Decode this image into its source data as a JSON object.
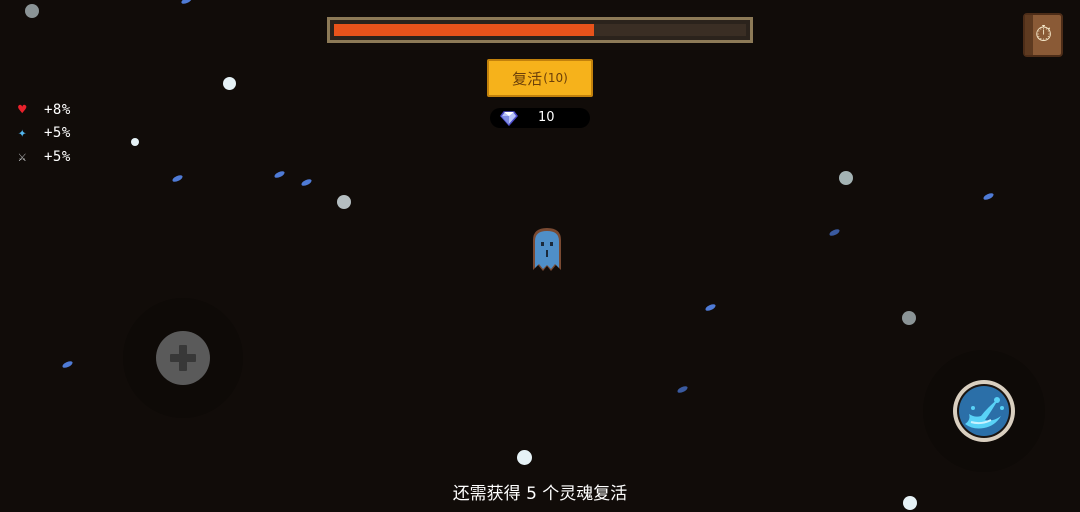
{
  "hud": {
    "progress": 0.63,
    "revive_button": {
      "label": "复活",
      "cost": "(10)"
    },
    "gems": {
      "count": "10",
      "icon": "diamond-icon"
    },
    "menu_icon": "book-icon"
  },
  "buffs": [
    {
      "icon": "heart-icon",
      "value": "+8%",
      "color": "#e8212b"
    },
    {
      "icon": "energy-icon",
      "value": "+5%",
      "color": "#53b7f0"
    },
    {
      "icon": "sword-icon",
      "value": "+5%",
      "color": "#cfd2d3"
    }
  ],
  "controls": {
    "joystick_icon": "plus-icon",
    "skill_icon": "water-splash-icon"
  },
  "hint": "还需获得 5 个灵魂复活",
  "colors": {
    "background": "#110c09",
    "progress_fill": "#e8531b",
    "button": "#f6b21b",
    "ghost": "#4f8fc8"
  }
}
